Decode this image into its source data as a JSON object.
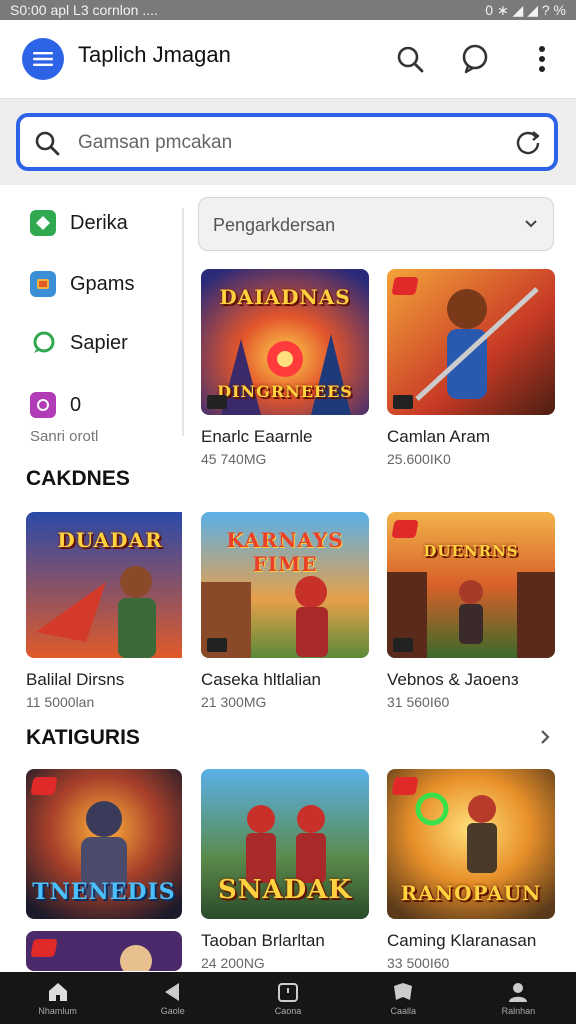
{
  "status_bar": {
    "left_text": "S0:00 apl L3 cornlon  ....",
    "right_text": "0 ∗ ◢ ◢ ? %"
  },
  "app_bar": {
    "title": "Taplich Jmagan"
  },
  "search": {
    "placeholder": "Gamsan pmcakan"
  },
  "categories": [
    {
      "label": "Derika",
      "icon": "diamond-icon",
      "color": "#2fa84f"
    },
    {
      "label": "Gpams",
      "icon": "gamepad-icon",
      "color": "#3a8fd6"
    },
    {
      "label": "Sapier",
      "icon": "chat-bubble-icon",
      "color": "#2fa84f"
    },
    {
      "label": "0",
      "icon": "puzzle-icon",
      "color": "#b23bb8"
    }
  ],
  "categories_footer": "Sanri orotl",
  "filter_select": {
    "value": "Pengarkdersan"
  },
  "featured_cards": [
    {
      "title": "Enarlc Eaarnle",
      "meta": "45 740MG",
      "thumb_text": "DAIADNAS",
      "thumb_text_bottom": "DINGRNEEES"
    },
    {
      "title": "Camlan Aram",
      "meta": "25.600IK0",
      "thumb_text": "",
      "thumb_text_bottom": ""
    }
  ],
  "section_1": {
    "title": "CAKDNES",
    "cards": [
      {
        "title": "Balilal Dirsns",
        "meta": "11 5000lan",
        "thumb_text": "DUADAR"
      },
      {
        "title": "Caseka hltlalian",
        "meta": "21 300MG",
        "thumb_text": "KARNAYS FIME"
      },
      {
        "title": "Vebnos & Jaoenз",
        "meta": "31 560I60",
        "thumb_text": "DUENRNS"
      }
    ]
  },
  "section_2": {
    "title": "KATIGURIS",
    "cards": [
      {
        "title": "",
        "meta": "",
        "thumb_text": "TNENEDIS"
      },
      {
        "title": "Taoban Brlarltan",
        "meta": "24 200NG",
        "thumb_text": "SNADAK"
      },
      {
        "title": "Caming Klaranasan",
        "meta": "33 500I60",
        "thumb_text": "RANOPAUN"
      }
    ]
  },
  "bottom_nav": [
    {
      "label": "Nhamlum",
      "icon": "home-icon"
    },
    {
      "label": "Gaole",
      "icon": "back-icon"
    },
    {
      "label": "Caona",
      "icon": "clock-icon"
    },
    {
      "label": "Caalla",
      "icon": "tag-icon"
    },
    {
      "label": "Ralnhan",
      "icon": "profile-icon"
    }
  ]
}
